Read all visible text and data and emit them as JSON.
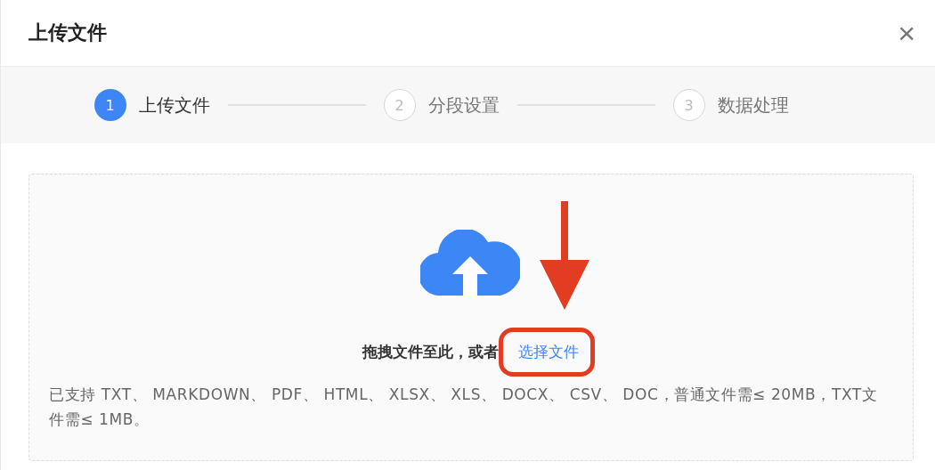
{
  "dialog": {
    "title": "上传文件",
    "close": "×"
  },
  "steps": [
    {
      "number": "1",
      "label": "上传文件",
      "selected": true
    },
    {
      "number": "2",
      "label": "分段设置",
      "selected": false
    },
    {
      "number": "3",
      "label": "数据处理",
      "selected": false
    }
  ],
  "upload": {
    "prompt": "拖拽文件至此，或者",
    "link": "选择文件",
    "note": "已支持 TXT、 MARKDOWN、 PDF、 HTML、 XLSX、 XLS、 DOCX、 CSV、 DOC，普通文件需≤ 20MB，TXT文件需≤ 1MB。"
  }
}
